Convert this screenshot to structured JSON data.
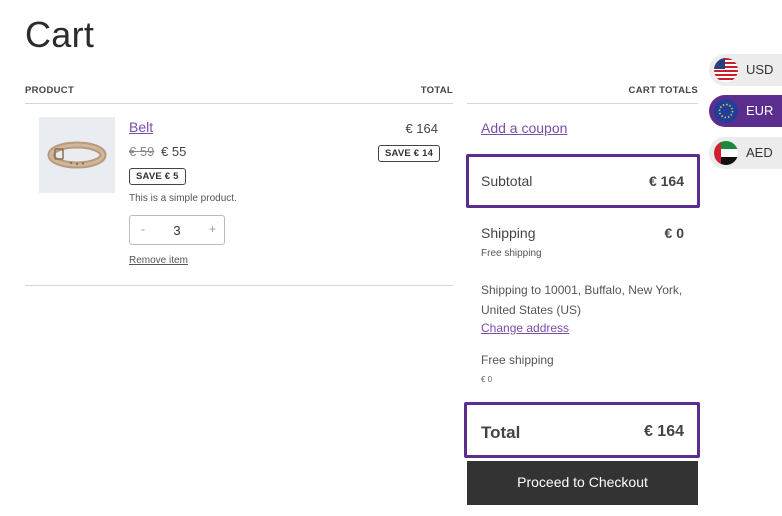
{
  "page": {
    "title": "Cart"
  },
  "cart_table": {
    "headers": {
      "product": "PRODUCT",
      "total": "TOTAL"
    },
    "item": {
      "name": "Belt",
      "price_original": "€ 59",
      "price_sale": "€ 55",
      "save_badge": "SAVE € 5",
      "description": "This is a simple product.",
      "quantity": "3",
      "qty_minus": "-",
      "qty_plus": "+",
      "remove_label": "Remove item",
      "line_total": "€ 164",
      "line_save_badge": "SAVE € 14"
    }
  },
  "totals": {
    "heading": "CART TOTALS",
    "coupon_link": "Add a coupon",
    "subtotal_label": "Subtotal",
    "subtotal_value": "€ 164",
    "shipping_label": "Shipping",
    "shipping_value": "€ 0",
    "shipping_method": "Free shipping",
    "shipping_destination": "Shipping to 10001, Buffalo, New York, United States (US)",
    "change_address": "Change address",
    "free_shipping_label": "Free shipping",
    "free_shipping_value": "€ 0",
    "total_label": "Total",
    "total_value": "€ 164",
    "checkout_button": "Proceed to Checkout"
  },
  "currency_switcher": {
    "options": [
      {
        "code": "USD",
        "flag": "us-flag-icon",
        "selected": false
      },
      {
        "code": "EUR",
        "flag": "eu-flag-icon",
        "selected": true
      },
      {
        "code": "AED",
        "flag": "uae-flag-icon",
        "selected": false
      }
    ],
    "active_color": "#5b2d8e"
  },
  "colors": {
    "link": "#7a4da8",
    "highlight_border": "#5b2d8e",
    "button_bg": "#333333"
  }
}
